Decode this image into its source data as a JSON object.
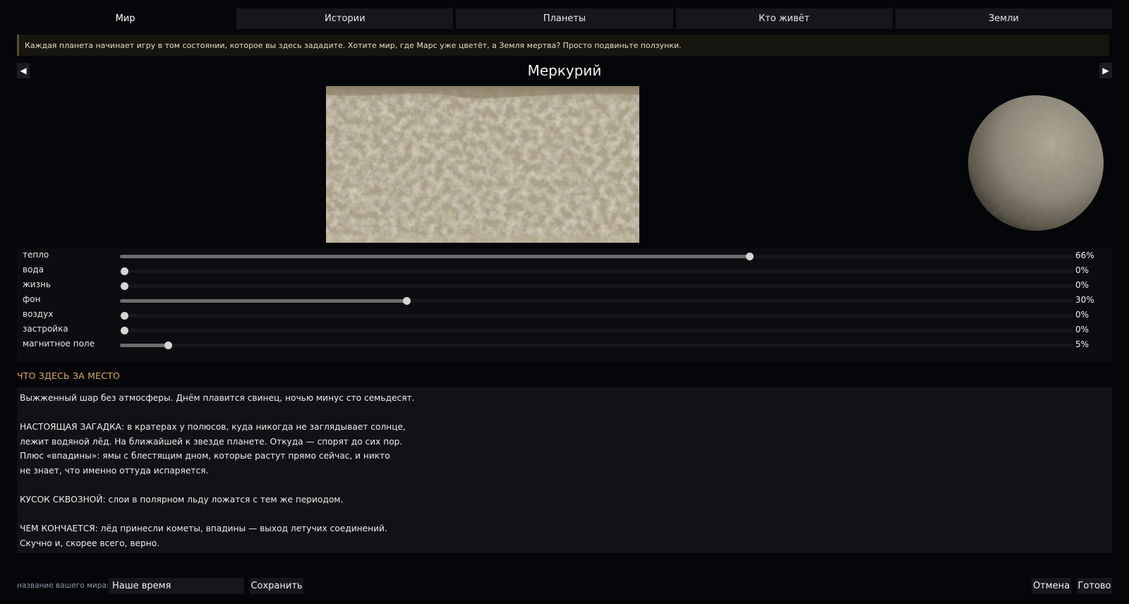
{
  "tabs": [
    {
      "label": "Мир"
    },
    {
      "label": "Истории"
    },
    {
      "label": "Планеты"
    },
    {
      "label": "Кто живёт"
    },
    {
      "label": "Земли"
    }
  ],
  "notice": "Каждая планета начинает игру в том состоянии, которое вы здесь зададите. Хотите мир, где Марс уже цветёт, а Земля мертва? Просто подвиньте ползунки.",
  "planet": {
    "prev_icon": "◀",
    "next_icon": "▶",
    "name": "Меркурий"
  },
  "sliders": [
    {
      "label": "тепло",
      "value": 66,
      "display": "66%"
    },
    {
      "label": "вода",
      "value": 0,
      "display": "0%"
    },
    {
      "label": "жизнь",
      "value": 0,
      "display": "0%"
    },
    {
      "label": "фон",
      "value": 30,
      "display": "30%"
    },
    {
      "label": "воздух",
      "value": 0,
      "display": "0%"
    },
    {
      "label": "застройка",
      "value": 0,
      "display": "0%"
    },
    {
      "label": "магнитное поле",
      "value": 5,
      "display": "5%"
    }
  ],
  "section_title": "ЧТО ЗДЕСЬ ЗА МЕСТО",
  "description": {
    "p1": "Выжженный шар без атмосферы. Днём плавится свинец, ночью минус сто семьдесят.",
    "p2": "НАСТОЯЩАЯ ЗАГАДКА: в кратерах у полюсов, куда никогда не заглядывает солнце,\nлежит водяной лёд. На ближайшей к звезде планете. Откуда — спорят до сих пор.\nПлюс «впадины»: ямы с блестящим дном, которые растут прямо сейчас, и никто\nне знает, что именно оттуда испаряется.",
    "p3": "КУСОК СКВОЗНОЙ: слои в полярном льду ложатся с тем же периодом.",
    "p4": "ЧЕМ КОНЧАЕТСЯ: лёд принесли кометы, впадины — выход летучих соединений.\nСкучно и, скорее всего, верно."
  },
  "footer": {
    "name_label": "название вашего мира:",
    "name_value": "Наше время",
    "save_label": "Сохранить",
    "cancel_label": "Отмена",
    "done_label": "Готово"
  },
  "colors": {
    "accent": "#e0a85c",
    "slider_fill": "#6d6d6d",
    "knob": "#d4d4d4",
    "surface": "#b1a68e"
  }
}
